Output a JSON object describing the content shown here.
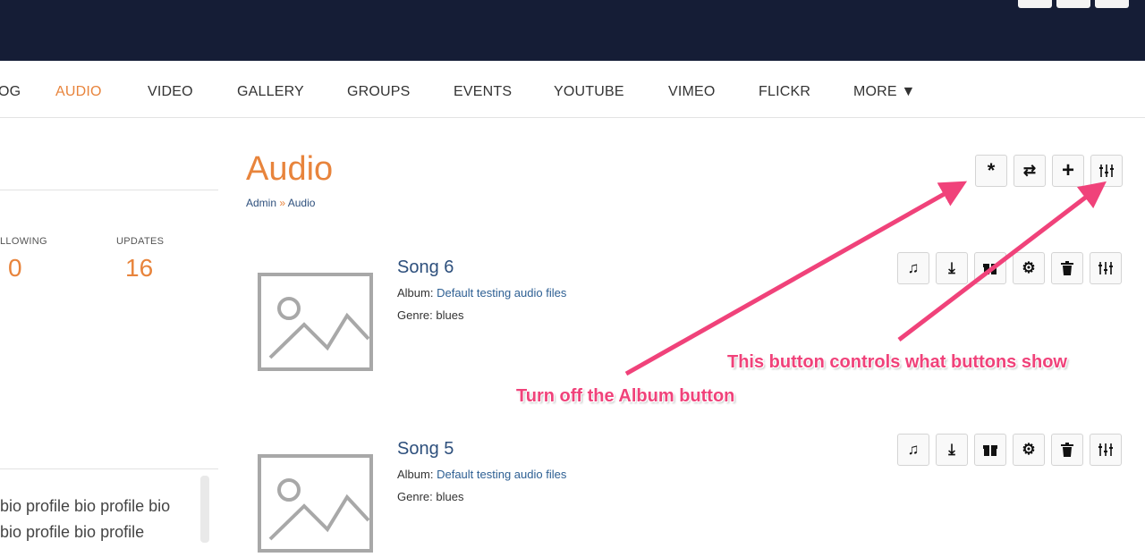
{
  "colors": {
    "accent": "#e8843c",
    "header_bg": "#151d36",
    "link": "#2d4f7c",
    "annotation": "#f0427a"
  },
  "nav": {
    "items": [
      {
        "label": "OG",
        "active": false
      },
      {
        "label": "AUDIO",
        "active": true
      },
      {
        "label": "VIDEO",
        "active": false
      },
      {
        "label": "GALLERY",
        "active": false
      },
      {
        "label": "GROUPS",
        "active": false
      },
      {
        "label": "EVENTS",
        "active": false
      },
      {
        "label": "YOUTUBE",
        "active": false
      },
      {
        "label": "VIMEO",
        "active": false
      },
      {
        "label": "FLICKR",
        "active": false
      },
      {
        "label": "MORE ▼",
        "active": false
      }
    ]
  },
  "profile": {
    "stats": [
      {
        "label": "LLOWING",
        "value": "0"
      },
      {
        "label": "UPDATES",
        "value": "16"
      }
    ],
    "bio_lines": [
      "bio profile bio profile bio",
      "bio profile bio profile"
    ]
  },
  "page": {
    "title": "Audio",
    "breadcrumb": {
      "root": "Admin",
      "separator": "»",
      "current": "Audio"
    }
  },
  "header_actions": [
    {
      "icon": "asterisk-icon",
      "glyph": "*"
    },
    {
      "icon": "refresh-icon",
      "glyph": "⇄"
    },
    {
      "icon": "plus-icon",
      "glyph": "+"
    },
    {
      "icon": "sliders-icon",
      "glyph": "⇅"
    }
  ],
  "songs": [
    {
      "title": "Song 6",
      "album_label": "Album:",
      "album": "Default testing audio files",
      "genre_label": "Genre:",
      "genre": "blues",
      "actions": [
        "music-icon",
        "download-icon",
        "gift-icon",
        "gear-icon",
        "trash-icon",
        "sliders-icon"
      ]
    },
    {
      "title": "Song 5",
      "album_label": "Album:",
      "album": "Default testing audio files",
      "genre_label": "Genre:",
      "genre": "blues",
      "actions": [
        "music-icon",
        "download-icon",
        "gift-icon",
        "gear-icon",
        "trash-icon",
        "sliders-icon"
      ]
    }
  ],
  "annotations": {
    "album_note": "Turn off the Album button",
    "controls_note": "This button controls what buttons show"
  }
}
